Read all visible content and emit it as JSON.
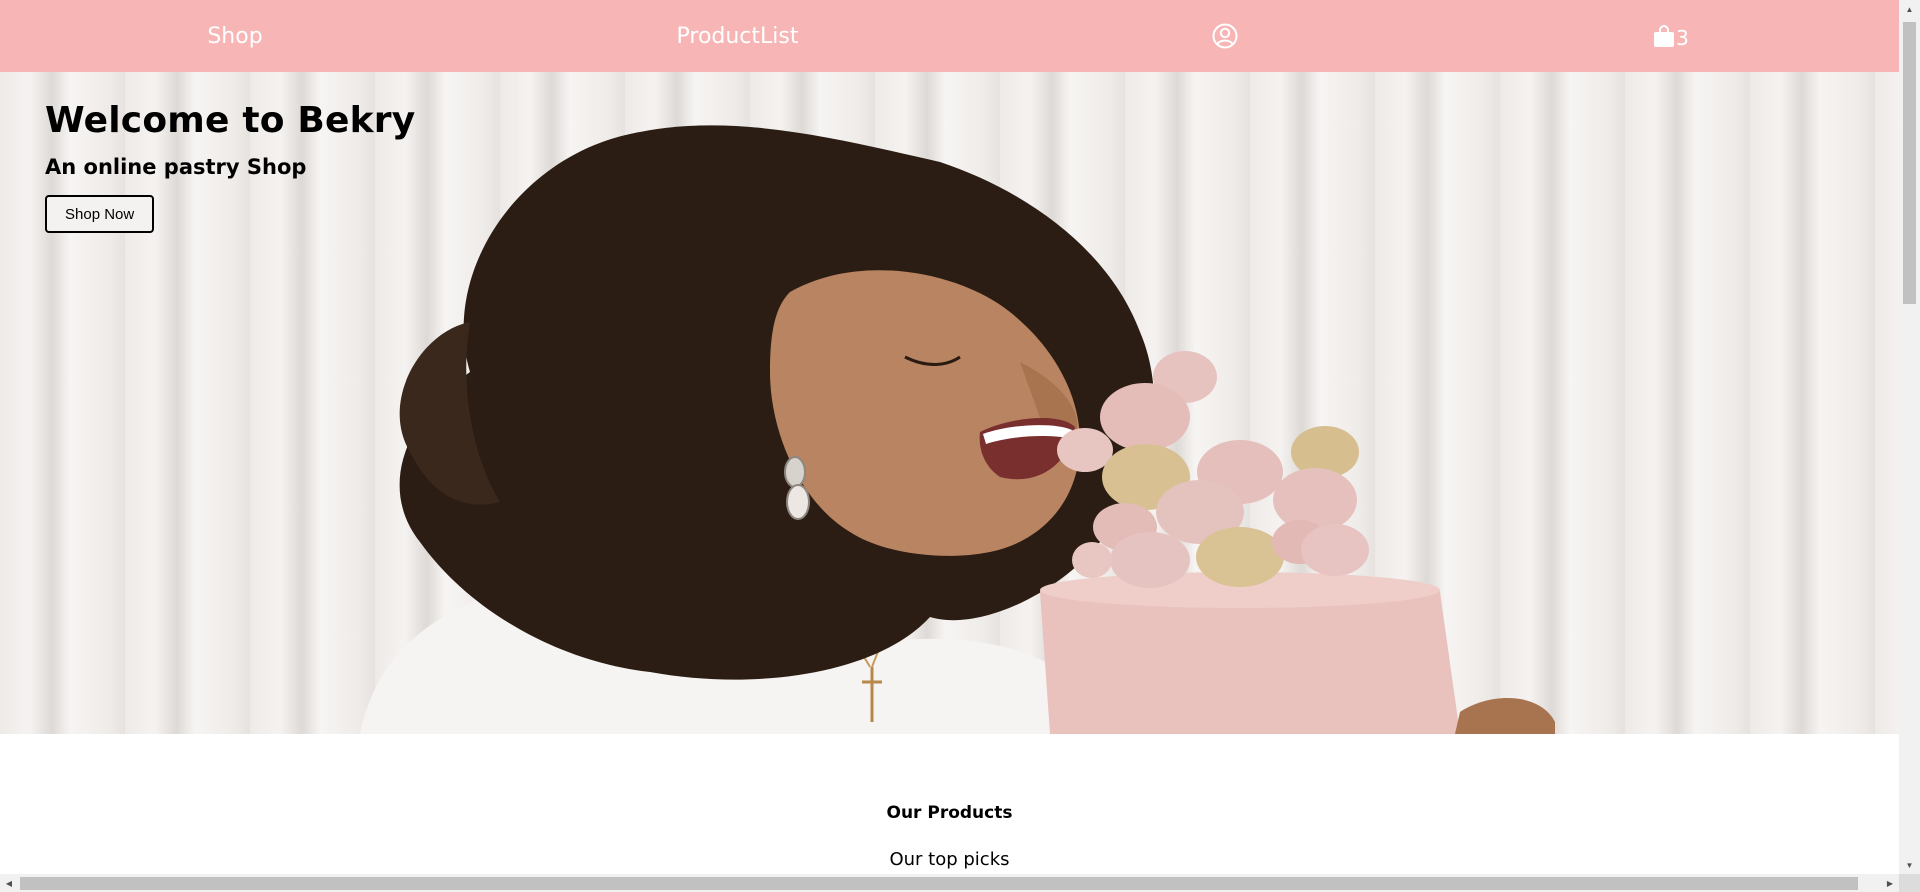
{
  "nav": {
    "shop_label": "Shop",
    "productlist_label": "ProductList",
    "user_icon": "user-circle-icon",
    "cart_icon": "shopping-bag-icon",
    "cart_count": "3"
  },
  "hero": {
    "title": "Welcome to Bekry",
    "subtitle": "An online pastry Shop",
    "button_label": "Shop Now"
  },
  "products": {
    "heading": "Our Products",
    "subheading": "Our top picks"
  },
  "colors": {
    "navbar": "#f7b5b5",
    "nav_text": "#ffffff",
    "cake": "#e9c2bd"
  }
}
